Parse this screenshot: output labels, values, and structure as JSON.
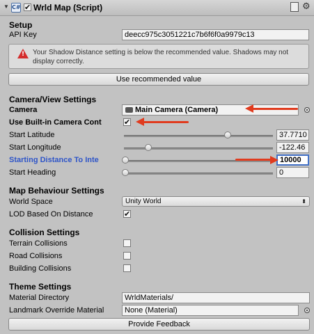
{
  "header": {
    "title": "Wrld Map (Script)",
    "enabled": true,
    "fold_icon": "triangle-down",
    "script_icon": "C#",
    "help_icon": "book-icon",
    "settings_icon": "gear-icon"
  },
  "setup": {
    "heading": "Setup",
    "api_key_label": "API Key",
    "api_key_value": "deecc975c3051221c7b6f6f0a9979c13",
    "warning": "Your Shadow Distance setting is below the recommended value. Shadows may not display correctly.",
    "recommended_button": "Use recommended value"
  },
  "camera": {
    "heading": "Camera/View Settings",
    "camera_label": "Camera",
    "camera_value": "Main Camera (Camera)",
    "builtin_label": "Use Built-in Camera Cont",
    "builtin_checked": "✔",
    "start_latitude_label": "Start Latitude",
    "start_latitude_value": "37.7710",
    "start_latitude_level": 0.9,
    "start_longitude_label": "Start Longitude",
    "start_longitude_value": "-122.46",
    "start_longitude_level": 0.18,
    "distance_label": "Starting Distance To Inte",
    "distance_value": "10000",
    "distance_level": 0.0,
    "heading_label": "Start Heading",
    "heading_value": "0",
    "heading_level": 0.0
  },
  "map_behaviour": {
    "heading": "Map Behaviour Settings",
    "world_space_label": "World Space",
    "world_space_value": "Unity World",
    "lod_label": "LOD Based On Distance",
    "lod_checked": "✔"
  },
  "collision": {
    "heading": "Collision Settings",
    "terrain_label": "Terrain Collisions",
    "road_label": "Road Collisions",
    "building_label": "Building Collisions"
  },
  "theme": {
    "heading": "Theme Settings",
    "material_dir_label": "Material Directory",
    "material_dir_value": "WrldMaterials/",
    "landmark_label": "Landmark Override Material",
    "landmark_value": "None (Material)"
  },
  "feedback_button": "Provide Feedback",
  "colors": {
    "annotation_arrow": "#e03b1e",
    "active_label": "#2f55c8",
    "panel_bg": "#c2c2c2"
  }
}
